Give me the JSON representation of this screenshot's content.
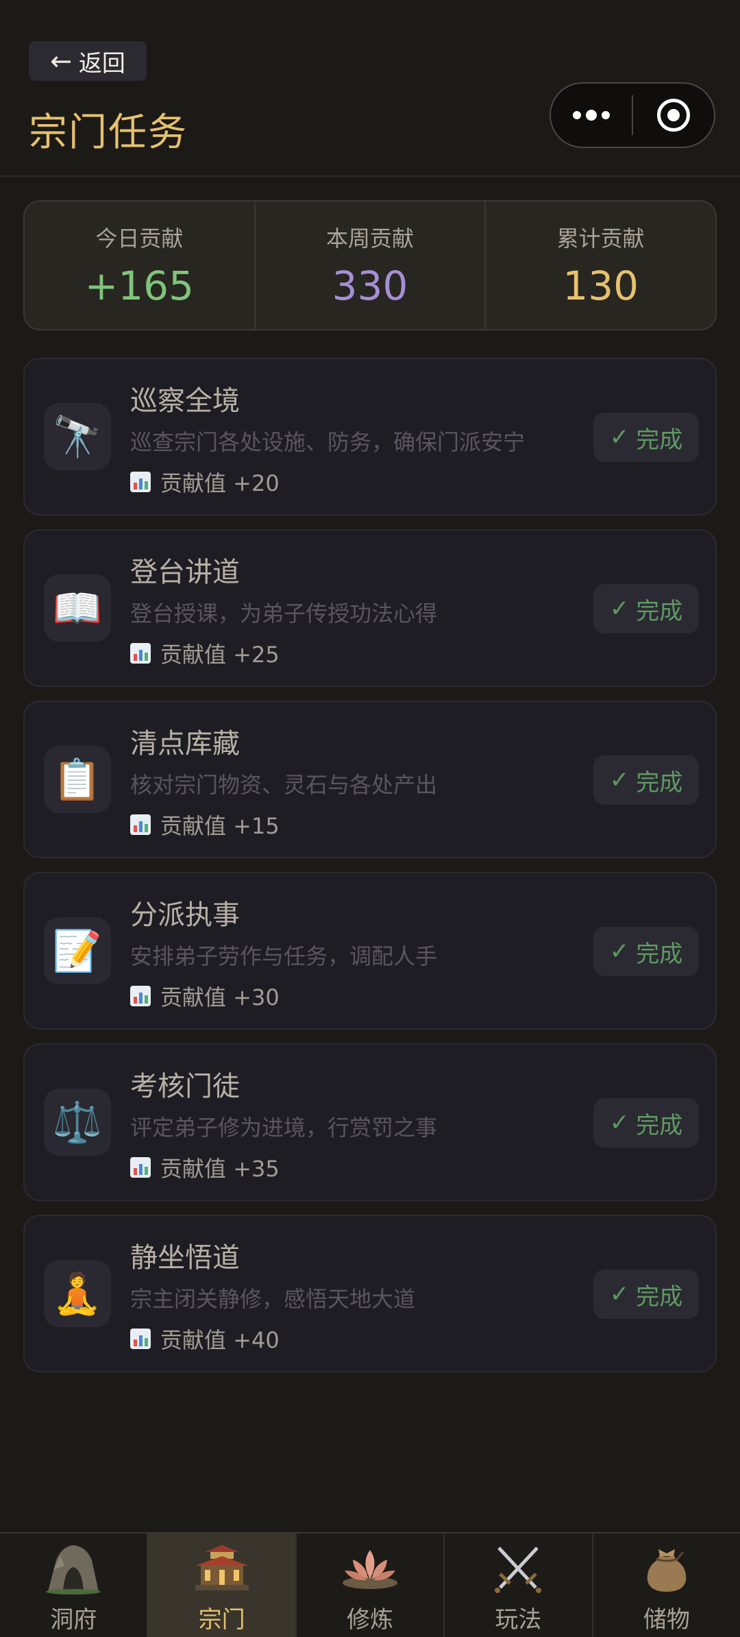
{
  "header": {
    "back_arrow": "←",
    "back_label": "返回",
    "title": "宗门任务"
  },
  "stats": [
    {
      "label": "今日贡献",
      "value": "+165",
      "color": "#7fc47a"
    },
    {
      "label": "本周贡献",
      "value": "330",
      "color": "#a68fd6"
    },
    {
      "label": "累计贡献",
      "value": "130",
      "color": "#e6c16e"
    }
  ],
  "tasks": [
    {
      "icon": "telescope-icon",
      "emoji": "🔭",
      "name": "巡察全境",
      "desc": "巡查宗门各处设施、防务，确保门派安宁",
      "reward": "贡献值 +20",
      "button": "完成"
    },
    {
      "icon": "book-icon",
      "emoji": "📖",
      "name": "登台讲道",
      "desc": "登台授课，为弟子传授功法心得",
      "reward": "贡献值 +25",
      "button": "完成"
    },
    {
      "icon": "clipboard-icon",
      "emoji": "📋",
      "name": "清点库藏",
      "desc": "核对宗门物资、灵石与各处产出",
      "reward": "贡献值 +15",
      "button": "完成"
    },
    {
      "icon": "memo-icon",
      "emoji": "📝",
      "name": "分派执事",
      "desc": "安排弟子劳作与任务，调配人手",
      "reward": "贡献值 +30",
      "button": "完成"
    },
    {
      "icon": "scales-icon",
      "emoji": "⚖️",
      "name": "考核门徒",
      "desc": "评定弟子修为进境，行赏罚之事",
      "reward": "贡献值 +35",
      "button": "完成"
    },
    {
      "icon": "meditation-icon",
      "emoji": "🧘",
      "name": "静坐悟道",
      "desc": "宗主闭关静修，感悟天地大道",
      "reward": "贡献值 +40",
      "button": "完成"
    }
  ],
  "tabbar": [
    {
      "label": "洞府",
      "icon": "cave-icon",
      "active": false
    },
    {
      "label": "宗门",
      "icon": "temple-icon",
      "active": true
    },
    {
      "label": "修炼",
      "icon": "lotus-icon",
      "active": false
    },
    {
      "label": "玩法",
      "icon": "crossed-swords-icon",
      "active": false
    },
    {
      "label": "储物",
      "icon": "pouch-icon",
      "active": false
    }
  ]
}
